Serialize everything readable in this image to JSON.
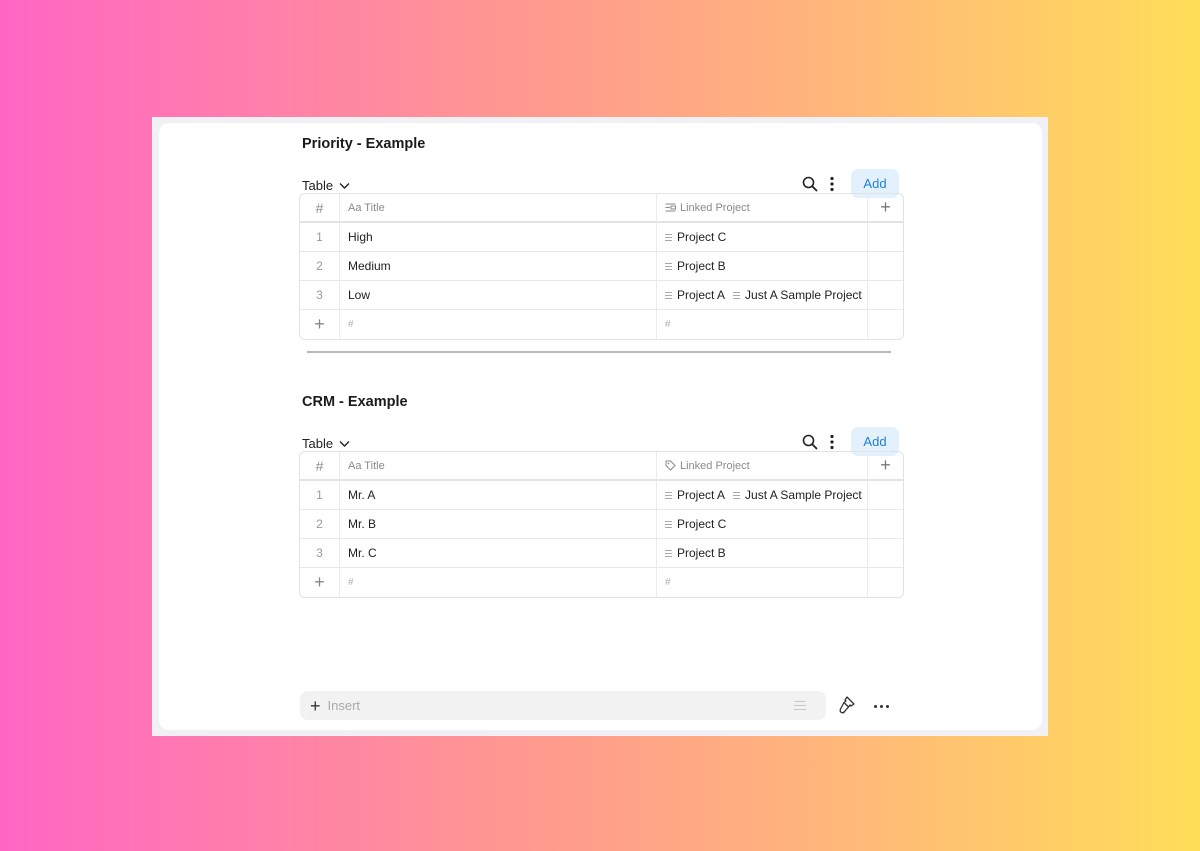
{
  "sections": [
    {
      "title": "Priority - Example",
      "view": "Table",
      "add_label": "Add",
      "columns": {
        "num": "#",
        "title": "Aa Title",
        "linked": "Linked Project",
        "linked_icon": "relation-icon"
      },
      "rows": [
        {
          "num": "1",
          "title": "High",
          "links": [
            "Project C"
          ]
        },
        {
          "num": "2",
          "title": "Medium",
          "links": [
            "Project B"
          ]
        },
        {
          "num": "3",
          "title": "Low",
          "links": [
            "Project A",
            "Just A Sample Project"
          ]
        }
      ],
      "footer": {
        "hash1": "#",
        "hash2": "#"
      }
    },
    {
      "title": "CRM - Example",
      "view": "Table",
      "add_label": "Add",
      "columns": {
        "num": "#",
        "title": "Aa Title",
        "linked": "Linked Project",
        "linked_icon": "tag-icon"
      },
      "rows": [
        {
          "num": "1",
          "title": "Mr. A",
          "links": [
            "Project A",
            "Just A Sample Project"
          ]
        },
        {
          "num": "2",
          "title": "Mr. B",
          "links": [
            "Project C"
          ]
        },
        {
          "num": "3",
          "title": "Mr. C",
          "links": [
            "Project B"
          ]
        }
      ],
      "footer": {
        "hash1": "#",
        "hash2": "#"
      }
    }
  ],
  "insert_bar": {
    "placeholder": "Insert"
  },
  "colors": {
    "accent": "#1f7fd4",
    "accent_bg": "#e3f1fd",
    "gradient_start": "#ff66c4",
    "gradient_end": "#ffde59"
  }
}
